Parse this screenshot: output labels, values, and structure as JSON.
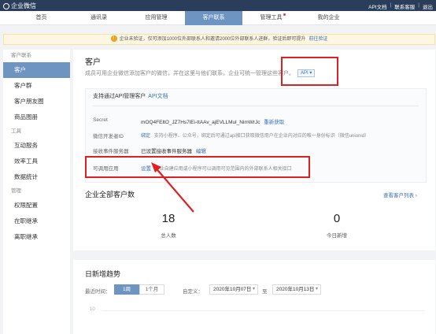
{
  "topbar": {
    "logo_text": "企业微信",
    "links": [
      "API文档",
      "联系客服",
      "退出"
    ]
  },
  "nav": {
    "items": [
      "首页",
      "通讯录",
      "应用管理",
      "客户联系",
      "管理工具",
      "我的企业"
    ],
    "active_index": 3
  },
  "notice": {
    "text": "企业未验证，仅可添加1000位外部联系人和邀请2000位外部联系人进群，验证后即可提升",
    "link": "前往验证"
  },
  "sidebar": {
    "sections": [
      {
        "title": "客户联系",
        "items": [
          "客户",
          "客户群",
          "客户朋友圈",
          "商品图册"
        ]
      },
      {
        "title": "工具",
        "items": [
          "互动服务",
          "效率工具",
          "数据统计"
        ]
      },
      {
        "title": "管理",
        "items": [
          "权限配置",
          "在职继承",
          "离职继承"
        ]
      }
    ],
    "active_item": "客户"
  },
  "main": {
    "title": "客户",
    "description": "成员可用企业微信添加客户的微信，并在这里与他们联系，企业可统一管理这些客户。",
    "api_tag": "API ▾",
    "card": {
      "title": "支持通过API管理客户",
      "title_link": "API文档",
      "rows": [
        {
          "label": "Secret",
          "value": "mOQ4FEltO_JZ7Hs7lEi-ttAAv_ajEVLLMul_NimWrJc",
          "link": "重新获取"
        },
        {
          "label": "微信开发者ID",
          "value_link": "绑定",
          "note": "支持小程序、公众号，绑定后可通过api接口获取微信用户在企业内对应的唯一身份标识（微信unionid）"
        },
        {
          "label": "接收事件服务器",
          "value": "已设置接收事件服务器",
          "link": "编辑"
        },
        {
          "label": "可调用应用",
          "value_link": "设置",
          "note": "企业自建应用或小程序可以调用可见范围内的外部联系人相关接口"
        }
      ]
    },
    "stats": {
      "title": "企业全部客户数",
      "link": "查看客户列表 ›",
      "items": [
        {
          "value": "18",
          "label": "总人数"
        },
        {
          "value": "0",
          "label": "今日新增"
        }
      ]
    },
    "trend": {
      "title": "日新增趋势",
      "range_label": "最近时间：",
      "segments": [
        "1周",
        "1个月"
      ],
      "active_segment": 0,
      "custom_label": "自定义：",
      "start_date": "2020年10月07日",
      "to_label": "至",
      "end_date": "2020年10月13日",
      "axis_first_tick": "10"
    }
  },
  "colors": {
    "topbar_bg": "#2a3d5a",
    "accent": "#6e94c2",
    "link": "#3a6ebc",
    "annotation_red": "#e02020"
  }
}
